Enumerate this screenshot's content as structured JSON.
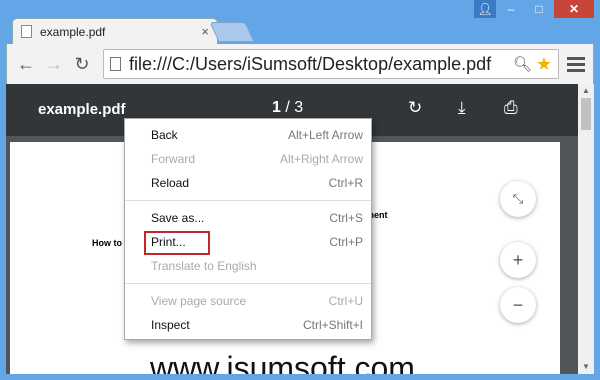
{
  "tab": {
    "title": "example.pdf",
    "close": "×"
  },
  "toolbar": {
    "url": "file:///C:/Users/iSumsoft/Desktop/example.pdf"
  },
  "pdf": {
    "title": "example.pdf",
    "current_page": "1",
    "page_separator": "/",
    "total_pages": "3"
  },
  "page_content": {
    "heading_fragment": "ment",
    "howto_fragment": "How to",
    "watermark": "www.isumsoft.com"
  },
  "context_menu": {
    "groups": [
      [
        {
          "label": "Back",
          "shortcut": "Alt+Left Arrow",
          "enabled": true
        },
        {
          "label": "Forward",
          "shortcut": "Alt+Right Arrow",
          "enabled": false
        },
        {
          "label": "Reload",
          "shortcut": "Ctrl+R",
          "enabled": true
        }
      ],
      [
        {
          "label": "Save as...",
          "shortcut": "Ctrl+S",
          "enabled": true
        },
        {
          "label": "Print...",
          "shortcut": "Ctrl+P",
          "enabled": true,
          "highlighted": true
        },
        {
          "label": "Translate to English",
          "shortcut": "",
          "enabled": false
        }
      ],
      [
        {
          "label": "View page source",
          "shortcut": "Ctrl+U",
          "enabled": false
        },
        {
          "label": "Inspect",
          "shortcut": "Ctrl+Shift+I",
          "enabled": true
        }
      ]
    ]
  },
  "colors": {
    "highlight_border": "#c0282b",
    "pdf_toolbar": "#323639",
    "star": "#f0b400"
  }
}
